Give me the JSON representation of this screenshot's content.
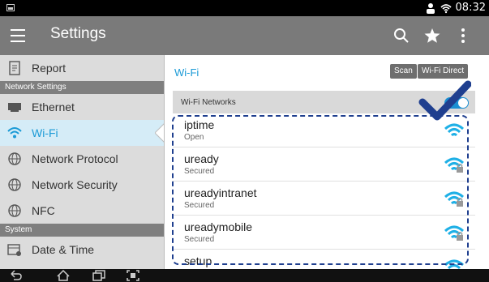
{
  "status_bar": {
    "time": "08:32",
    "icons": [
      "notification-icon",
      "person-icon",
      "wifi-icon"
    ]
  },
  "app_bar": {
    "title": "Settings",
    "actions": [
      "search-icon",
      "star-icon",
      "more-vert-icon"
    ]
  },
  "sidebar": {
    "items": [
      {
        "type": "item",
        "label": "Report",
        "icon": "report-icon"
      },
      {
        "type": "section",
        "label": "Network Settings"
      },
      {
        "type": "item",
        "label": "Ethernet",
        "icon": "ethernet-icon"
      },
      {
        "type": "item",
        "label": "Wi-Fi",
        "icon": "wifi-icon",
        "active": true
      },
      {
        "type": "item",
        "label": "Network Protocol",
        "icon": "globe-icon"
      },
      {
        "type": "item",
        "label": "Network Security",
        "icon": "globe-icon"
      },
      {
        "type": "item",
        "label": "NFC",
        "icon": "globe-icon"
      },
      {
        "type": "section",
        "label": "System"
      },
      {
        "type": "item",
        "label": "Date & Time",
        "icon": "calendar-icon"
      }
    ]
  },
  "content": {
    "heading": "Wi-Fi",
    "scan_label": "Scan",
    "wifi_direct_label": "Wi-Fi Direct",
    "networks_label": "Wi-Fi Networks",
    "wifi_enabled": true,
    "networks": [
      {
        "ssid": "iptime",
        "security": "Open",
        "locked": false
      },
      {
        "ssid": "uready",
        "security": "Secured",
        "locked": true
      },
      {
        "ssid": "ureadyintranet",
        "security": "Secured",
        "locked": true
      },
      {
        "ssid": "ureadymobile",
        "security": "Secured",
        "locked": true
      },
      {
        "ssid": "setup",
        "security": "",
        "locked": false
      }
    ]
  },
  "colors": {
    "accent": "#1a9ad6",
    "app_bar": "#7a7a7a",
    "sidebar": "#dcdcdc",
    "section": "#7f7f7f",
    "annotation": "#1f3f8f"
  },
  "nav_bar": {
    "icons": [
      "back-icon",
      "home-icon",
      "recents-icon",
      "screenshot-icon"
    ]
  }
}
